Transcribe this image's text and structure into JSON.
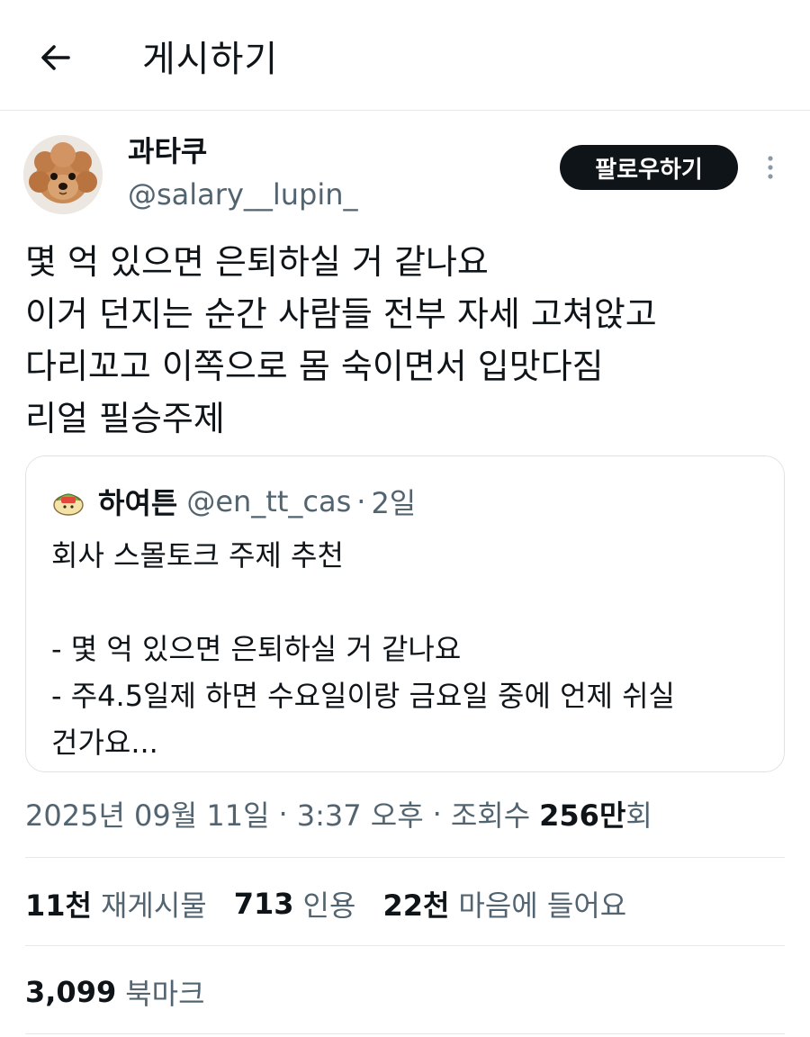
{
  "header": {
    "title": "게시하기",
    "back_icon": "arrow-left-icon"
  },
  "author": {
    "display_name": "과타쿠",
    "handle": "@salary__lupin_",
    "follow_label": "팔로우하기",
    "more_icon": "more-vertical-icon"
  },
  "tweet": {
    "lines": [
      "몇 억 있으면 은퇴하실 거 같나요",
      "이거 던지는 순간 사람들 전부 자세 고쳐앉고",
      "다리꼬고 이쪽으로 몸 숙이면서 입맛다짐",
      "리얼 필승주제"
    ]
  },
  "quote": {
    "name": "하여튼",
    "handle": "@en_tt_cas",
    "dot": "·",
    "time": "2일",
    "lines": [
      "회사 스몰토크 주제 추천",
      "",
      "- 몇 억 있으면 은퇴하실 거 같나요",
      "- 주4.5일제 하면 수요일이랑 금요일 중에 언제 쉬실",
      "건가요..."
    ]
  },
  "meta": {
    "date": "2025년 09월 11일",
    "sep": "·",
    "time": "3:37 오후",
    "views_label": "조회수",
    "views_count": "256만",
    "views_suffix": "회"
  },
  "stats": {
    "reposts_count": "11천",
    "reposts_label": "재게시물",
    "quotes_count": "713",
    "quotes_label": "인용",
    "likes_count": "22천",
    "likes_label": "마음에 들어요",
    "bookmarks_count": "3,099",
    "bookmarks_label": "북마크"
  },
  "colors": {
    "text_primary": "#0f1419",
    "text_secondary": "#536471",
    "border": "#e6e8ea",
    "follow_bg": "#0f1419"
  }
}
